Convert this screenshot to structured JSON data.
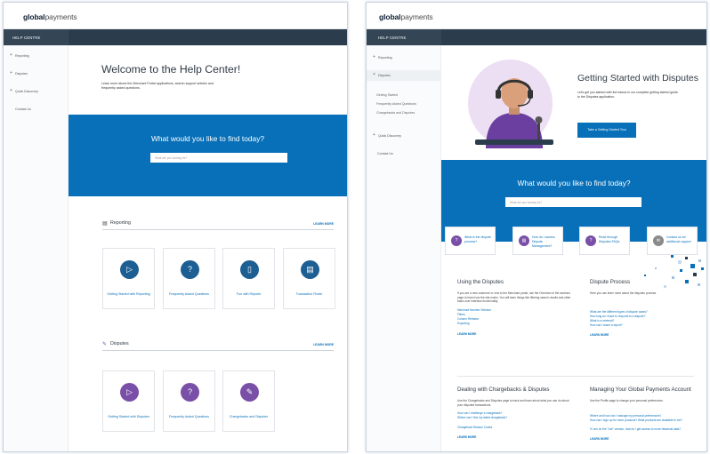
{
  "brand": {
    "bold": "global",
    "light": "payments"
  },
  "header": {
    "help_centre": "HELP CENTRE"
  },
  "left_panel": {
    "sidebar": [
      {
        "icon": "+",
        "label": "Reporting"
      },
      {
        "icon": "+",
        "label": "Disputes"
      },
      {
        "icon": "+",
        "label": "Quick Discovery"
      },
      {
        "icon": "",
        "label": "Contact Us"
      }
    ],
    "welcome": {
      "title": "Welcome to the Help Center!",
      "body": "Learn more about the Merchant Portal applications, search support articles and frequently asked questions."
    },
    "search": {
      "question": "What would you like to find today?",
      "placeholder": "What are you looking for?"
    },
    "reporting": {
      "title": "Reporting",
      "learn_more": "LEARN MORE",
      "cards": [
        {
          "icon": "play-icon",
          "label": "Getting Started with Reporting"
        },
        {
          "icon": "question-icon",
          "label": "Frequently Asked Questions"
        },
        {
          "icon": "document-icon",
          "label": "Fun with Reports"
        },
        {
          "icon": "document-icon",
          "label": "Transaction Finder"
        }
      ]
    },
    "disputes": {
      "title": "Disputes",
      "learn_more": "LEARN MORE",
      "cards": [
        {
          "icon": "play-icon",
          "label": "Getting Started with Disputes"
        },
        {
          "icon": "question-icon",
          "label": "Frequently Asked Questions"
        },
        {
          "icon": "pen-icon",
          "label": "Chargebacks and Disputes"
        }
      ]
    }
  },
  "right_panel": {
    "sidebar": {
      "reporting": "Reporting",
      "disputes": "Disputes",
      "sub": [
        "Getting Started",
        "Frequently Asked Questions",
        "Chargebacks and Disputes"
      ],
      "quick_discovery": "Quick Discovery",
      "contact": "Contact Us"
    },
    "hero": {
      "title": "Getting Started with Disputes",
      "body": "Let's get you started with the basics in our complete getting started guide to the Disputes application.",
      "button": "Take a Getting Started Tour"
    },
    "search": {
      "question": "What would you like to find today?",
      "placeholder": "What are you looking for?"
    },
    "quick_cards": [
      {
        "label": "What is the dispute process?"
      },
      {
        "label": "How do I access Dispute Management?"
      },
      {
        "label": "Read through Disputes FAQs"
      },
      {
        "label": "Contact us for additional support"
      }
    ],
    "using": {
      "title": "Using the Disputes",
      "body": "If you are a new customer or new to the Merchant portal, use the Overview of the sections page to learn how the site works. You will learn things like filtering search results and other basic user interface functionality.",
      "links": [
        "Merchant Number Selector",
        "Filters",
        "Column Reframe",
        "Exporting"
      ],
      "learn_more": "LEARN MORE"
    },
    "process": {
      "title": "Dispute Process",
      "body": "Here you can learn more about the disputes process.",
      "links": [
        "What are the different types of dispute cases?",
        "How long do I have to respond to a dispute?",
        "What is a retrieval?",
        "How can I share a report?"
      ],
      "learn_more": "LEARN MORE"
    },
    "chargebacks": {
      "title": "Dealing with Chargebacks & Disputes",
      "body": "Use the Chargebacks and Disputes page to track and learn about what you can do about your disputed transactions.",
      "links": [
        "How can I challenge a chargeback?",
        "Where can I find my latest chargeback?"
      ],
      "links2": [
        "Chargeback Reason Codes"
      ],
      "learn_more": "LEARN MORE"
    },
    "account": {
      "title": "Managing Your Global Payments Account",
      "body": "Use the Profile page to change your personal preferences.",
      "links": [
        "Where and how can I manage my personal preferences?",
        "How can I sign up for more products? What products are available to me?"
      ],
      "links2": [
        "If I am on the \"Lite\" version, how do I get access to more historical data?"
      ],
      "learn_more": "LEARN MORE"
    }
  },
  "colors": {
    "primary": "#0770b9",
    "navy": "#2b3c4c",
    "purple": "#7a4fa8",
    "icon_blue": "#1d5f93"
  }
}
